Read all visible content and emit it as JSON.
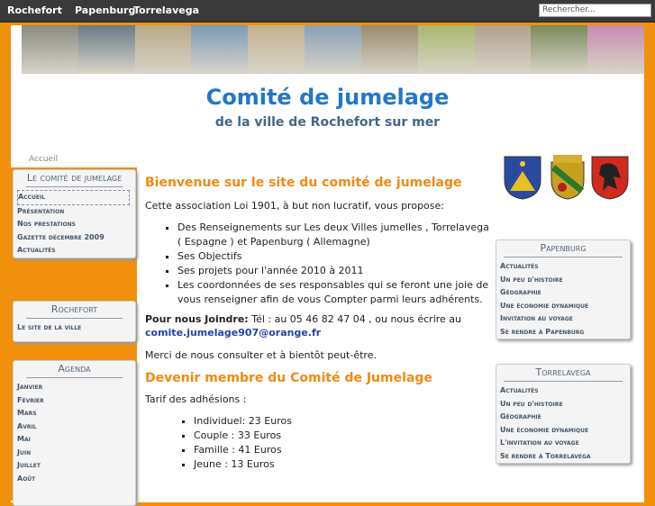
{
  "topnav": [
    "Rochefort",
    "Papenburg",
    "Torrelavega"
  ],
  "search_placeholder": "Rechercher...",
  "site_title": "Comité de jumelage",
  "site_subtitle": "de la ville de Rochefort sur mer",
  "breadcrumb": "Accueil",
  "left_boxes": [
    {
      "title": "Le comité de jumelage",
      "items": [
        "Accueil",
        "Présentation",
        "Nos prestations",
        "Gazette décembre 2009",
        "Actualités"
      ]
    },
    {
      "title": "Rochefort",
      "items": [
        "Le site de la ville"
      ]
    },
    {
      "title": "Agenda",
      "items": [
        "Janvier",
        "Février",
        "Mars",
        "Avril",
        "Mai",
        "Juin",
        "Juillet",
        "Août"
      ]
    }
  ],
  "right_boxes": [
    {
      "title": "Papenburg",
      "items": [
        "Actualités",
        "Un peu d'histoire",
        "Géographie",
        "Une économie dynamique",
        "Invitation au voyage",
        "Se rendre à Papenburg"
      ]
    },
    {
      "title": "Torrelavega",
      "items": [
        "Actualités",
        "Un peu d'histoire",
        "Géographie",
        "Une économie dynamique",
        "L'invitation au voyage",
        "Se rendre à Torrelavega"
      ]
    }
  ],
  "content": {
    "h1": "Bienvenue sur le site du comité de jumelage",
    "intro": "Cette association Loi 1901, à but non lucratif, vous propose:",
    "list1": [
      "Des Renseignements sur Les deux Villes jumelles , Torrelavega ( Espagne ) et Papenburg ( Allemagne)",
      "Ses Objectifs",
      "Ses projets pour l'année 2010 à 2011",
      "Les coordonnées de ses responsables qui se feront une joie de vous renseigner afin de vous Compter parmi leurs adhérents."
    ],
    "join_label": "Pour nous Joindre:",
    "join_text": " Tél : au 05 46 82 47 04 , ou nous écrire au",
    "email": "comite.jumelage907@orange.fr",
    "thanks": "Merci de nous consulter et à bientôt peut-être.",
    "h2": "Devenir membre du Comité de Jumelage",
    "tarif": "Tarif des adhésions :",
    "prices": [
      "Individuel: 23 Euros",
      "Couple : 33 Euros",
      "Famille : 41 Euros",
      "Jeune : 13 Euros"
    ]
  },
  "banner_colors": [
    "#8a8a80",
    "#6b7a88",
    "#b9a888",
    "#7a9ab8",
    "#c4b090",
    "#88a0b8",
    "#9a8a70",
    "#a8b870",
    "#b0a090",
    "#7a8a5a",
    "#c88ab0"
  ]
}
